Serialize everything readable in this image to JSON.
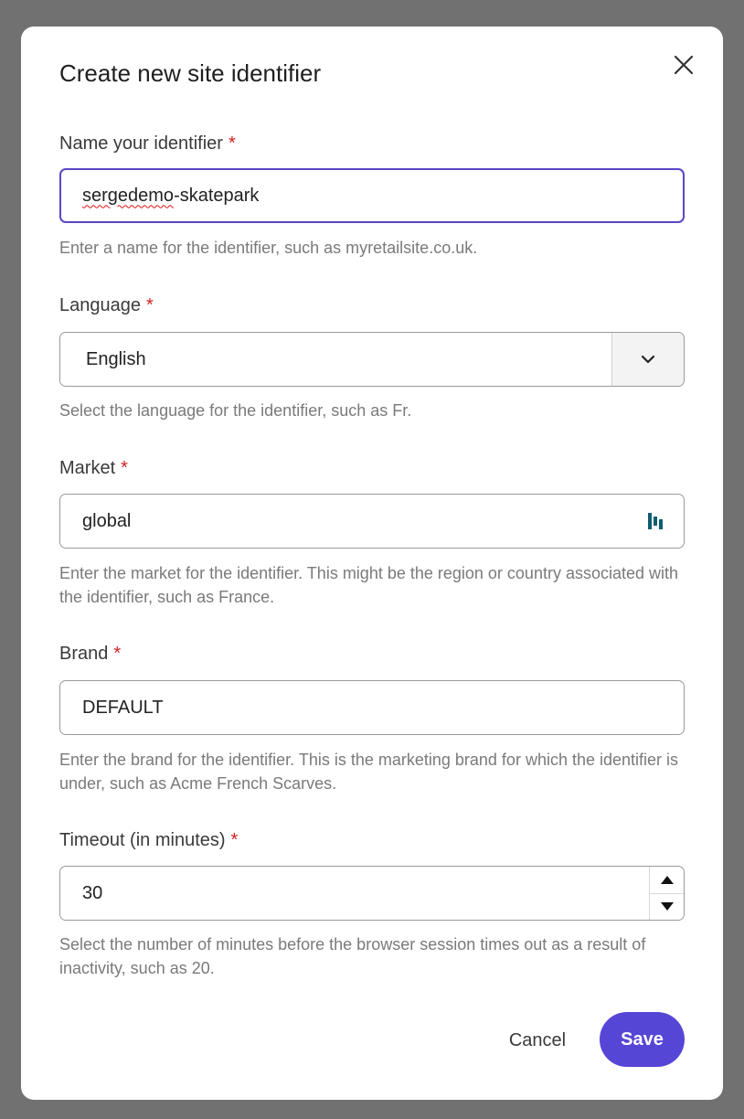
{
  "dialog": {
    "title": "Create new site identifier",
    "close_icon": "close-icon"
  },
  "fields": {
    "name": {
      "label": "Name your identifier",
      "required_mark": "*",
      "value_misspelled": "sergedemo",
      "value_rest": "-skatepark",
      "helper": "Enter a name for the identifier, such as myretailsite.co.uk."
    },
    "language": {
      "label": "Language",
      "required_mark": "*",
      "value": "English",
      "helper": "Select the language for the identifier, such as Fr."
    },
    "market": {
      "label": "Market",
      "required_mark": "*",
      "value": "global",
      "helper": "Enter the market for the identifier. This might be the region or country associated with the identifier, such as France."
    },
    "brand": {
      "label": "Brand",
      "required_mark": "*",
      "value": "DEFAULT",
      "helper": "Enter the brand for the identifier. This is the marketing brand for which the identifier is under, such as Acme French Scarves."
    },
    "timeout": {
      "label": "Timeout (in minutes)",
      "required_mark": "*",
      "value": "30",
      "helper": "Select the number of minutes before the browser session times out as a result of inactivity, such as 20."
    }
  },
  "actions": {
    "cancel_label": "Cancel",
    "save_label": "Save"
  },
  "colors": {
    "accent": "#5646d6",
    "focus_border": "#5b44c9",
    "required": "#d12020",
    "overlay": "#717171"
  }
}
